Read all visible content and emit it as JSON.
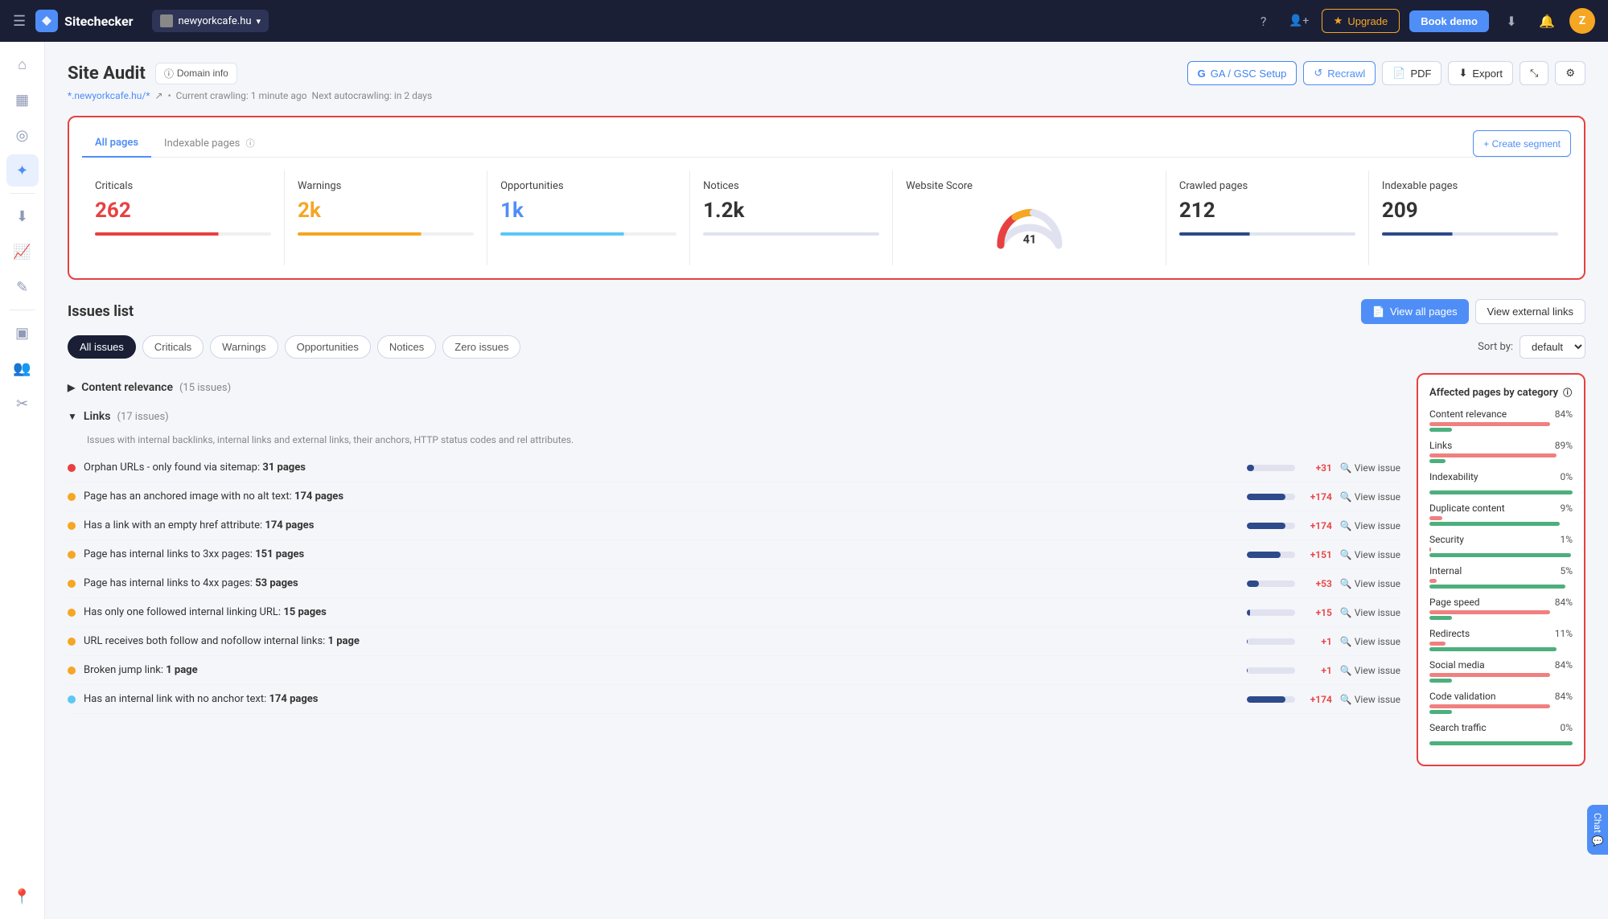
{
  "nav": {
    "logo_text": "Sitechecker",
    "site_name": "newyorkcafe.hu",
    "upgrade_label": "Upgrade",
    "book_demo_label": "Book demo",
    "avatar_letter": "Z"
  },
  "page": {
    "title": "Site Audit",
    "domain_info_label": "Domain info",
    "breadcrumb_url": "*.newyorkcafe.hu/*",
    "breadcrumb_crawl": "Current crawling: 1 minute ago",
    "breadcrumb_next": "Next autocrawling: in 2 days"
  },
  "header_buttons": {
    "ga_setup": "GA / GSC Setup",
    "recrawl": "Recrawl",
    "pdf": "PDF",
    "export": "Export"
  },
  "summary": {
    "tabs": [
      "All pages",
      "Indexable pages"
    ],
    "active_tab": 0,
    "create_segment_label": "+ Create segment",
    "cards": [
      {
        "label": "Criticals",
        "value": "262",
        "color": "red",
        "bar": "red"
      },
      {
        "label": "Warnings",
        "value": "2k",
        "color": "orange",
        "bar": "orange"
      },
      {
        "label": "Opportunities",
        "value": "1k",
        "color": "blue",
        "bar": "blue-light"
      },
      {
        "label": "Notices",
        "value": "1.2k",
        "color": "dark",
        "bar": "gray"
      },
      {
        "label": "Website Score",
        "value": "41",
        "color": "dark",
        "bar": "gauge"
      },
      {
        "label": "Crawled pages",
        "value": "212",
        "color": "dark",
        "bar": "navy"
      },
      {
        "label": "Indexable pages",
        "value": "209",
        "color": "dark",
        "bar": "navy"
      }
    ]
  },
  "issues_list": {
    "title": "Issues list",
    "view_all_pages_label": "View all pages",
    "view_external_links_label": "View external links",
    "filters": [
      "All issues",
      "Criticals",
      "Warnings",
      "Opportunities",
      "Notices",
      "Zero issues"
    ],
    "active_filter": "All issues",
    "sort_by_label": "Sort by:",
    "sort_option": "default",
    "categories": [
      {
        "name": "Content relevance",
        "count": "15 issues",
        "expanded": false,
        "issues": []
      },
      {
        "name": "Links",
        "count": "17 issues",
        "expanded": true,
        "description": "Issues with internal backlinks, internal links and external links, their anchors, HTTP status codes and rel attributes.",
        "issues": [
          {
            "label": "Orphan URLs - only found via sitemap:",
            "pages": "31 pages",
            "plus": "+31",
            "dot": "red",
            "fill_pct": 15
          },
          {
            "label": "Page has an anchored image with no alt text:",
            "pages": "174 pages",
            "plus": "+174",
            "dot": "orange",
            "fill_pct": 80
          },
          {
            "label": "Has a link with an empty href attribute:",
            "pages": "174 pages",
            "plus": "+174",
            "dot": "orange",
            "fill_pct": 80
          },
          {
            "label": "Page has internal links to 3xx pages:",
            "pages": "151 pages",
            "plus": "+151",
            "dot": "orange",
            "fill_pct": 70
          },
          {
            "label": "Page has internal links to 4xx pages:",
            "pages": "53 pages",
            "plus": "+53",
            "dot": "orange",
            "fill_pct": 25
          },
          {
            "label": "Has only one followed internal linking URL:",
            "pages": "15 pages",
            "plus": "+15",
            "dot": "orange",
            "fill_pct": 7
          },
          {
            "label": "URL receives both follow and nofollow internal links:",
            "pages": "1 page",
            "plus": "+1",
            "dot": "orange",
            "fill_pct": 1
          },
          {
            "label": "Broken jump link:",
            "pages": "1 page",
            "plus": "+1",
            "dot": "orange",
            "fill_pct": 1
          },
          {
            "label": "Has an internal link with no anchor text:",
            "pages": "174 pages",
            "plus": "+174",
            "dot": "blue",
            "fill_pct": 80
          }
        ]
      }
    ]
  },
  "affected_panel": {
    "title": "Affected pages by category",
    "categories": [
      {
        "name": "Content relevance",
        "pct": "84%",
        "red_w": 84,
        "green_w": 16
      },
      {
        "name": "Links",
        "pct": "89%",
        "red_w": 89,
        "green_w": 11
      },
      {
        "name": "Indexability",
        "pct": "0%",
        "red_w": 0,
        "green_w": 100
      },
      {
        "name": "Duplicate content",
        "pct": "9%",
        "red_w": 9,
        "green_w": 91
      },
      {
        "name": "Security",
        "pct": "1%",
        "red_w": 1,
        "green_w": 99
      },
      {
        "name": "Internal",
        "pct": "5%",
        "red_w": 5,
        "green_w": 95
      },
      {
        "name": "Page speed",
        "pct": "84%",
        "red_w": 84,
        "green_w": 16
      },
      {
        "name": "Redirects",
        "pct": "11%",
        "red_w": 11,
        "green_w": 89
      },
      {
        "name": "Social media",
        "pct": "84%",
        "red_w": 84,
        "green_w": 16
      },
      {
        "name": "Code validation",
        "pct": "84%",
        "red_w": 84,
        "green_w": 16
      },
      {
        "name": "Search traffic",
        "pct": "0%",
        "red_w": 0,
        "green_w": 100
      }
    ]
  },
  "sidebar": {
    "items": [
      {
        "icon": "⌂",
        "name": "home"
      },
      {
        "icon": "▦",
        "name": "dashboard"
      },
      {
        "icon": "◎",
        "name": "search"
      },
      {
        "icon": "✦",
        "name": "audit",
        "active": true
      },
      {
        "icon": "↓",
        "name": "download"
      },
      {
        "icon": "∿",
        "name": "analytics"
      },
      {
        "icon": "✎",
        "name": "edit"
      },
      {
        "icon": "▣",
        "name": "apps"
      },
      {
        "icon": "⚙",
        "name": "users"
      },
      {
        "icon": "✂",
        "name": "tools"
      }
    ]
  }
}
